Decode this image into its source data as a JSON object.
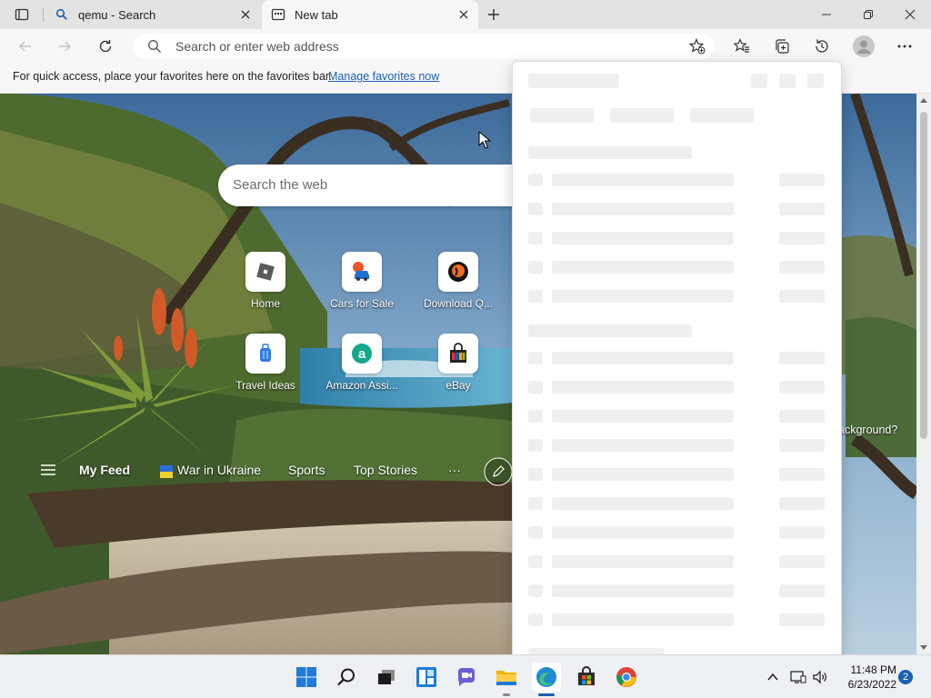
{
  "tabs": [
    {
      "title": "qemu - Search",
      "icon": "search-icon"
    },
    {
      "title": "New tab",
      "icon": "newtab-icon"
    }
  ],
  "address_bar": {
    "placeholder": "Search or enter web address"
  },
  "favorites_bar": {
    "message": "For quick access, place your favorites here on the favorites bar.",
    "link": "Manage favorites now"
  },
  "newtab": {
    "search_placeholder": "Search the web",
    "quick_links": [
      {
        "label": "Home",
        "icon": "roblox-icon"
      },
      {
        "label": "Cars for Sale",
        "icon": "car-icon"
      },
      {
        "label": "Download Q...",
        "icon": "qemu-icon"
      },
      {
        "label": "Travel Ideas",
        "icon": "luggage-icon"
      },
      {
        "label": "Amazon Assi...",
        "icon": "amazon-icon"
      },
      {
        "label": "eBay",
        "icon": "ebay-bag-icon"
      }
    ],
    "feed": {
      "items": [
        "My Feed",
        "War in Ukraine",
        "Sports",
        "Top Stories"
      ],
      "more": "···"
    },
    "background_question": "ackground?"
  },
  "taskbar": {
    "apps": [
      "start-icon",
      "search-icon",
      "task-view-icon",
      "widgets-icon",
      "teams-chat-icon",
      "file-explorer-icon",
      "edge-icon",
      "store-icon",
      "chrome-icon"
    ],
    "time": "11:48 PM",
    "date": "6/23/2022",
    "notifications": "2"
  },
  "colors": {
    "accent": "#1a5fb4",
    "tab_strip": "#e3e3e3",
    "toolbar": "#f7f7f7"
  }
}
